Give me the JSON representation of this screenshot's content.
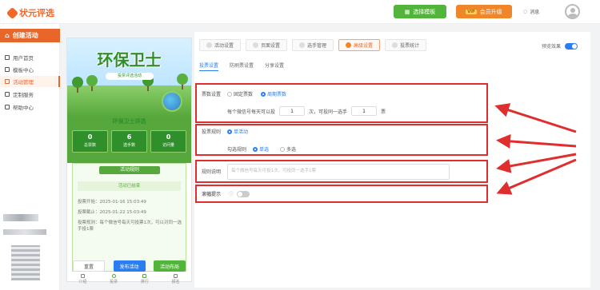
{
  "app": {
    "logo": "状元评选"
  },
  "topbar": {
    "select_template": "选择模板",
    "upgrade_badge": "VIP",
    "upgrade": "会员升级",
    "messages": "消息"
  },
  "sidebar": {
    "create": "创建活动",
    "items": [
      {
        "label": "用户首页"
      },
      {
        "label": "模板中心"
      },
      {
        "label": "活动管理"
      },
      {
        "label": "定制服务"
      },
      {
        "label": "帮助中心"
      }
    ]
  },
  "preview": {
    "title": "环保卫士",
    "subtitle": "投票评选活动",
    "band_title": "环保卫士评选",
    "stats": [
      {
        "value": "0",
        "label": "总票数"
      },
      {
        "value": "6",
        "label": "选手数"
      },
      {
        "value": "0",
        "label": "访问量"
      }
    ],
    "rules_title": "活动规则",
    "ended": "活动已结束",
    "rules": [
      "投票开始：2025-01-16 15:03:49",
      "投票截止：2025-01-22 15:03:49",
      "投票规则：每个微信号每天可投票1次，可以对同一选手投1票"
    ],
    "bottom_nav": [
      "介绍",
      "投票",
      "排行",
      "报名"
    ]
  },
  "actions": {
    "reset": "重置",
    "publish": "发布活动",
    "layout": "活动布局"
  },
  "pane": {
    "tabs": [
      "活动设置",
      "页面设置",
      "选手管理",
      "高级设置",
      "投票统计"
    ],
    "active_tab": "高级设置",
    "preview_effect": "预览效果",
    "subtabs": [
      "投票设置",
      "防刷票设置",
      "分享设置"
    ],
    "vote_setting": {
      "label": "票数设置",
      "options": [
        "固定票数",
        "周期票数"
      ],
      "selected": "周期票数",
      "text1": "每个微信号每天可以投",
      "count": "1",
      "text2": "次，可投同一选手",
      "per_player": "1",
      "text3": "票"
    },
    "vote_rule": {
      "label": "投票规则",
      "option": "单活动",
      "check_label": "勾选规则",
      "check_options": [
        "单选",
        "多选"
      ],
      "check_selected": "单选"
    },
    "rule_desc": {
      "label": "规则说明",
      "placeholder": "每个微信号每天可投1次，可投同一选手1票"
    },
    "scroll_tip": {
      "label": "滚幅提示"
    }
  }
}
